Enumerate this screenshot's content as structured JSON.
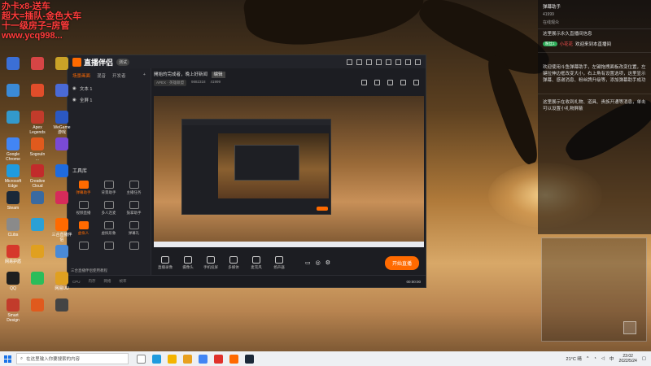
{
  "overlay_text": [
    "办卡x8-送车",
    "超大=插队-金色大车",
    "十一级房子=房管",
    "www.ycq998..."
  ],
  "desktop_icons": [
    {
      "label": "",
      "color": "#3b6fd6"
    },
    {
      "label": "",
      "color": "#d64545"
    },
    {
      "label": "",
      "color": "#c9a227"
    },
    {
      "label": "",
      "color": "#3b8ad6"
    },
    {
      "label": "",
      "color": "#e14d2a"
    },
    {
      "label": "",
      "color": "#4a6ad6"
    },
    {
      "label": "",
      "color": "#3399cc"
    },
    {
      "label": "Apex\nLegends",
      "color": "#c23b2b"
    },
    {
      "label": "WeGame\n游戏",
      "color": "#2b58c2"
    },
    {
      "label": "Google\nChrome",
      "color": "#4285f4"
    },
    {
      "label": "SogouIn\n...",
      "color": "#e05a1d"
    },
    {
      "label": "",
      "color": "#7a4ad6"
    },
    {
      "label": "Microsoft\nEdge",
      "color": "#1f9bde"
    },
    {
      "label": "Creative\nCloud",
      "color": "#c22b2b"
    },
    {
      "label": "",
      "color": "#1f6bde"
    },
    {
      "label": "Steam",
      "color": "#1b2838"
    },
    {
      "label": "",
      "color": "#3a6aa0"
    },
    {
      "label": "",
      "color": "#d62b5a"
    },
    {
      "label": "CLibs",
      "color": "#8a8a8a"
    },
    {
      "label": "",
      "color": "#2ba0d6"
    },
    {
      "label": "三合直播伴侣",
      "color": "#ff6a00"
    },
    {
      "label": "网易护盾",
      "color": "#d6382b"
    },
    {
      "label": "",
      "color": "#e0a020"
    },
    {
      "label": "",
      "color": "#4a8ad6"
    },
    {
      "label": "QQ",
      "color": "#1f1f1f"
    },
    {
      "label": "",
      "color": "#2bbd5a"
    },
    {
      "label": "网易UU",
      "color": "#e0a020"
    },
    {
      "label": "Smart\nDesign",
      "color": "#c23b2b"
    },
    {
      "label": "",
      "color": "#e05a1d"
    },
    {
      "label": "",
      "color": "#444"
    }
  ],
  "app": {
    "name": "直播伴侣",
    "badge": "测试",
    "left_tabs": [
      "场景画面",
      "混音",
      "开发者"
    ],
    "scenes": [
      "文本 1",
      "全屏 1"
    ],
    "tools_title": "工具库",
    "tools": [
      {
        "label": "弹幕助手",
        "hot": true
      },
      {
        "label": "背景助手",
        "hot": false
      },
      {
        "label": "主播任务",
        "hot": false
      },
      {
        "label": "视频直播",
        "hot": false
      },
      {
        "label": "多人连麦",
        "hot": false
      },
      {
        "label": "鼓掌助手",
        "hot": false
      },
      {
        "label": "虚拟人",
        "hot": true
      },
      {
        "label": "虚拟形象",
        "hot": false
      },
      {
        "label": "弹幕礼",
        "hot": false
      },
      {
        "label": "",
        "hot": false
      },
      {
        "label": "",
        "hot": false
      },
      {
        "label": "",
        "hot": false
      }
    ],
    "bottom_link": "三合直播伴侣使用教程",
    "stream_title": "開始的完成者，晚上好新闻",
    "edit_label": "编辑",
    "meta": {
      "tag": "APEX · 英雄联盟",
      "room": "9882318",
      "fans": "41999"
    },
    "controls": [
      "直播录像",
      "摄像头",
      "手机投屏",
      "多媒体",
      "麦克风",
      "扬声器"
    ],
    "live_button": "开始直播",
    "status_time": "00:00:00",
    "status_items": [
      "CPU",
      "内存",
      "网络",
      "帧率"
    ]
  },
  "right_panel": {
    "title": "弹幕助手",
    "count": "41999",
    "sub": "在线观众",
    "notice": "这里展示永久直播间信息",
    "welcome": {
      "level": "粉丝1",
      "nick": "小花花",
      "text": "欢迎来到本直播间"
    },
    "help": "欢迎使用斗鱼弹幕助手，左键拖拽面板改变位置，左键拉伸边框改变大小，右上角有设置选项，这里显示弹幕、感谢消息、粉丝牌升级等，添加弹幕助手成功",
    "gift_note": "这里展示在收到礼物、道具、贵族开通等消息，单击可以设置小礼物屏蔽"
  },
  "taskbar": {
    "search_placeholder": "在这里输入你要搜索的内容",
    "temp": "21°C 晴",
    "lang": "中",
    "time": "23:02",
    "date": "2022/5/24"
  }
}
